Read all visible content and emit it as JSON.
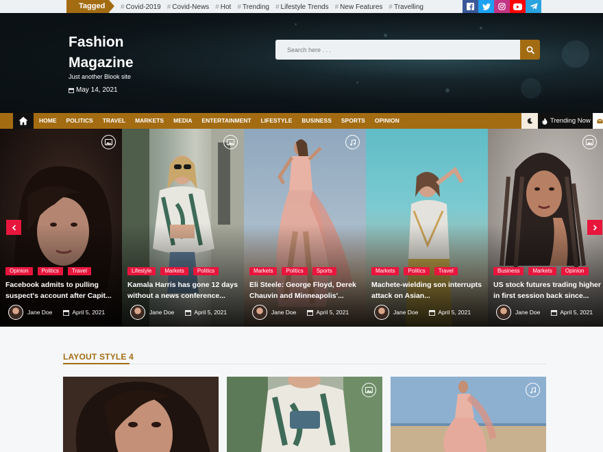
{
  "topbar": {
    "tagged_label": "Tagged",
    "tags": [
      "Covid-2019",
      "Covid-News",
      "Hot",
      "Trending",
      "Lifestyle Trends",
      "New Features",
      "Travelling"
    ],
    "social": [
      {
        "name": "facebook-icon",
        "color": "#3b5998"
      },
      {
        "name": "twitter-icon",
        "color": "#1da1f2"
      },
      {
        "name": "instagram-icon",
        "color": "#c13584"
      },
      {
        "name": "youtube-icon",
        "color": "#ff0000"
      },
      {
        "name": "telegram-icon",
        "color": "#2aa3df"
      }
    ]
  },
  "header": {
    "site_title": "Fashion Magazine",
    "site_description": "Just another Blook site",
    "date": "May 14, 2021",
    "search_placeholder": "Search here . . ."
  },
  "nav": {
    "items": [
      "HOME",
      "POLITICS",
      "TRAVEL",
      "MARKETS",
      "MEDIA",
      "ENTERTAINMENT",
      "LIFESTYLE",
      "BUSINESS",
      "SPORTS",
      "OPINION"
    ],
    "trending_label": "Trending Now"
  },
  "slider": {
    "slides": [
      {
        "categories": [
          "Opinion",
          "Politics",
          "Travel"
        ],
        "title": "Facebook admits to pulling suspect's account after Capit...",
        "author": "Jane Doe",
        "date": "April 5, 2021",
        "format_icon": "image-icon"
      },
      {
        "categories": [
          "Lifestyle",
          "Markets",
          "Politics"
        ],
        "title": "Kamala Harris has gone 12 days without a news conference...",
        "author": "Jane Doe",
        "date": "April 5, 2021",
        "format_icon": "image-icon"
      },
      {
        "categories": [
          "Markets",
          "Politics",
          "Sports"
        ],
        "title": "Eli Steele: George Floyd, Derek Chauvin and Minneapolis'...",
        "author": "Jane Doe",
        "date": "April 5, 2021",
        "format_icon": "music-icon"
      },
      {
        "categories": [
          "Markets",
          "Politics",
          "Travel"
        ],
        "title": "Machete-wielding son interrupts attack on Asian...",
        "author": "Jane Doe",
        "date": "April 5, 2021",
        "format_icon": "none"
      },
      {
        "categories": [
          "Business",
          "Markets",
          "Opinion"
        ],
        "title": "US stock futures trading higher in first session back since...",
        "author": "Jane Doe",
        "date": "April 5, 2021",
        "format_icon": "image-icon"
      }
    ]
  },
  "section": {
    "title": "LAYOUT STYLE 4"
  },
  "colors": {
    "accent": "#a36c12",
    "category": "#e8163d"
  }
}
